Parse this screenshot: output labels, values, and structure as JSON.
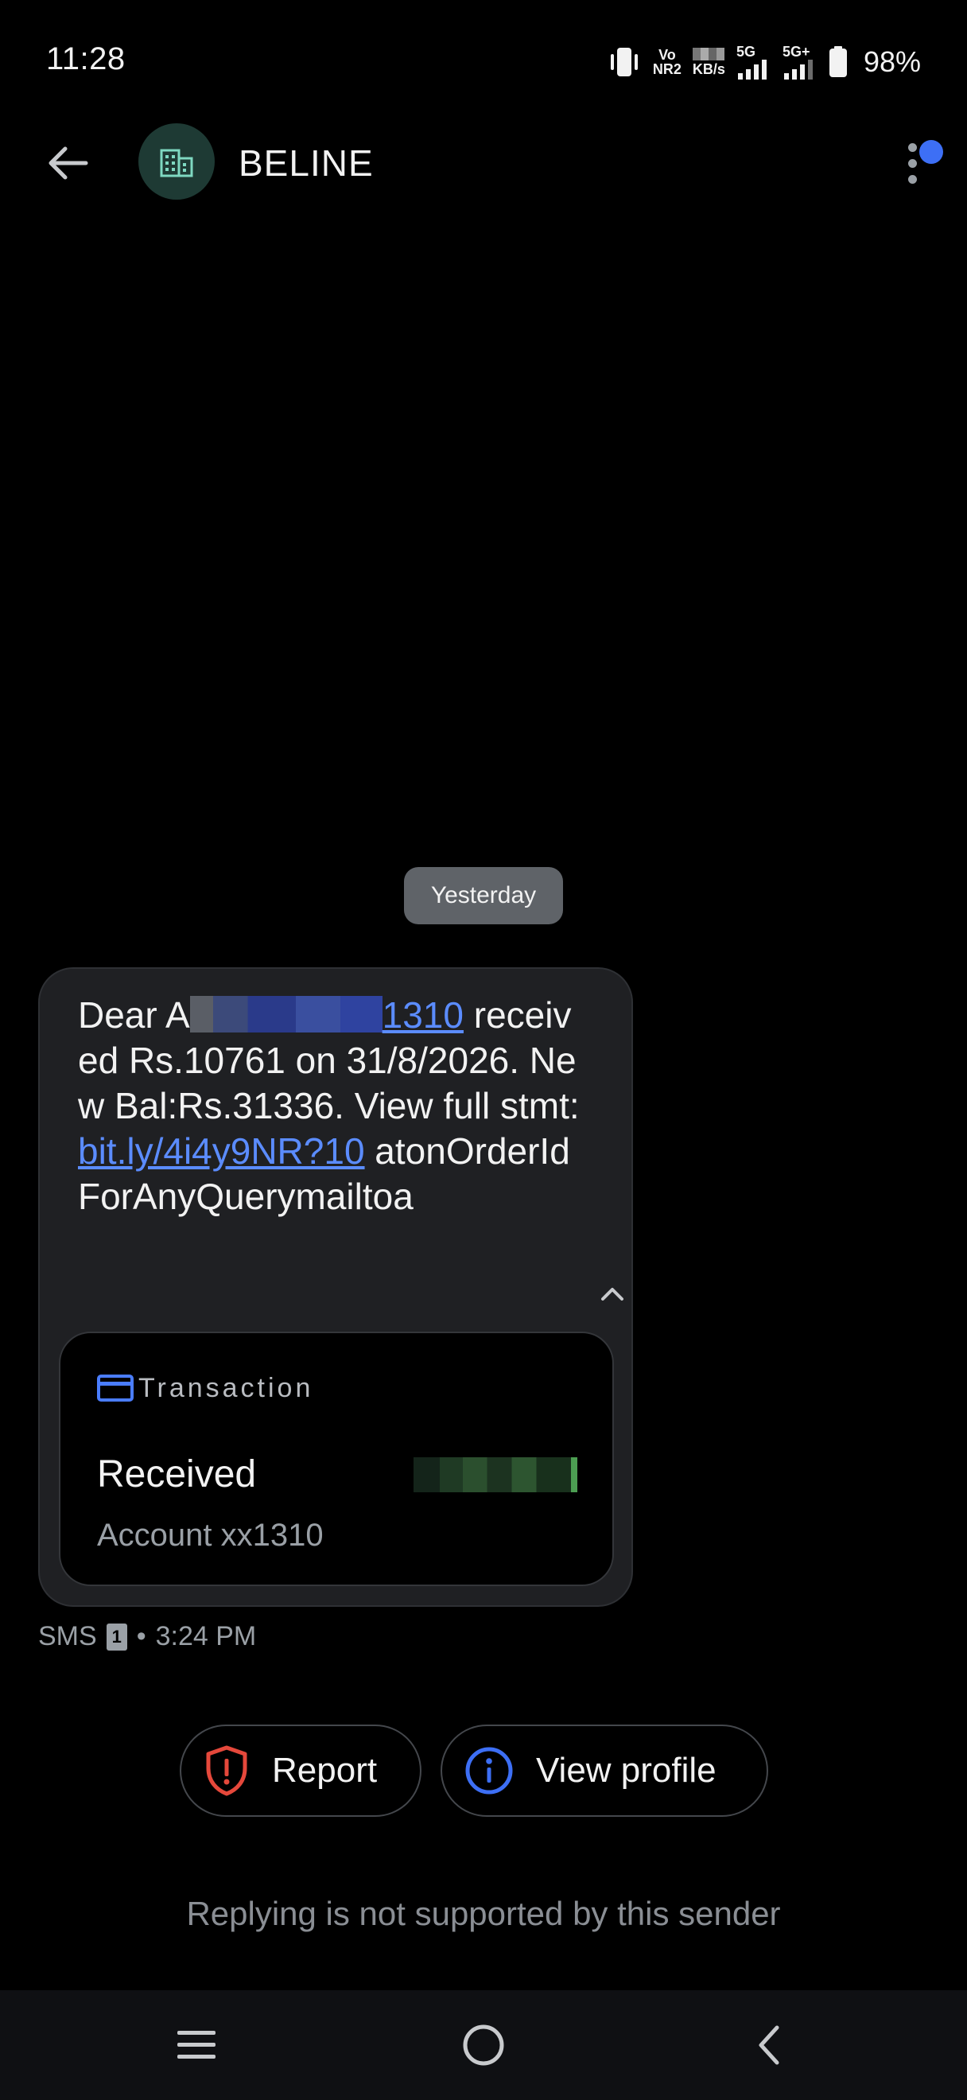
{
  "status_bar": {
    "time": "11:28",
    "volte_label_top": "Vo",
    "volte_label_bottom": "NR2",
    "speed_unit": "KB/s",
    "network_1": "5G",
    "network_2": "5G+",
    "battery": "98%"
  },
  "header": {
    "sender": "BELINE",
    "avatar_icon": "building-icon",
    "notification_color": "#3d6ff5"
  },
  "thread": {
    "date_chip": "Yesterday",
    "message": {
      "greeting": "Dear A",
      "account_suffix": "1310",
      "body_1": " received Rs.10761 on 31/8/2026. New Bal:Rs.31336. View full stmt: ",
      "link": "bit.ly/4i4y9NR?10",
      "body_2": " atonOrderIdForAnyQuerymailtoa"
    },
    "transaction_card": {
      "label": "Transaction",
      "title": "Received",
      "account": "Account xx1310"
    },
    "meta": {
      "type": "SMS",
      "sim": "1",
      "separator": "•",
      "time": "3:24 PM"
    }
  },
  "actions": {
    "report_label": "Report",
    "view_profile_label": "View profile"
  },
  "footer": {
    "reply_note": "Replying is not supported by this sender"
  },
  "colors": {
    "link": "#5b8cff",
    "report_icon": "#e5483b",
    "info_icon": "#3d6ff5"
  }
}
